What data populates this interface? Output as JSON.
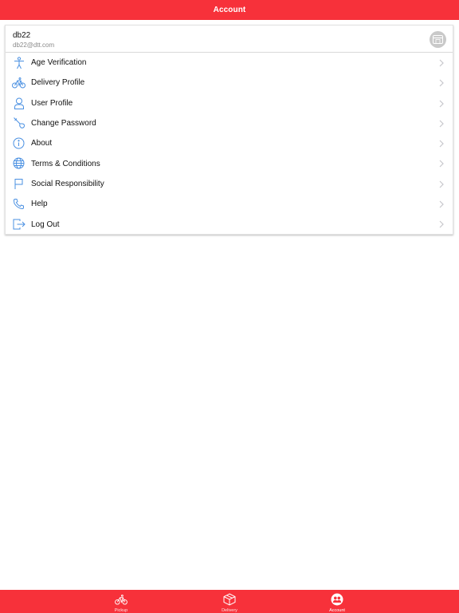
{
  "header": {
    "title": "Account"
  },
  "profile": {
    "name": "db22",
    "email": "db22@dtt.com"
  },
  "menu": [
    {
      "label": "Age Verification",
      "icon": "person-icon"
    },
    {
      "label": "Delivery Profile",
      "icon": "bicycle-icon"
    },
    {
      "label": "User Profile",
      "icon": "user-icon"
    },
    {
      "label": "Change Password",
      "icon": "key-icon"
    },
    {
      "label": "About",
      "icon": "info-icon"
    },
    {
      "label": "Terms & Conditions",
      "icon": "globe-icon"
    },
    {
      "label": "Social Responsibility",
      "icon": "flag-icon"
    },
    {
      "label": "Help",
      "icon": "phone-icon"
    },
    {
      "label": "Log Out",
      "icon": "logout-icon"
    }
  ],
  "tabs": [
    {
      "label": "Pickup",
      "icon": "bicycle-icon",
      "active": false
    },
    {
      "label": "Delivery",
      "icon": "box-icon",
      "active": false
    },
    {
      "label": "Account",
      "icon": "account-icon",
      "active": true
    }
  ],
  "colors": {
    "brand": "#f7313a",
    "icon": "#4a90e2",
    "chevron": "#c7c7cc"
  }
}
